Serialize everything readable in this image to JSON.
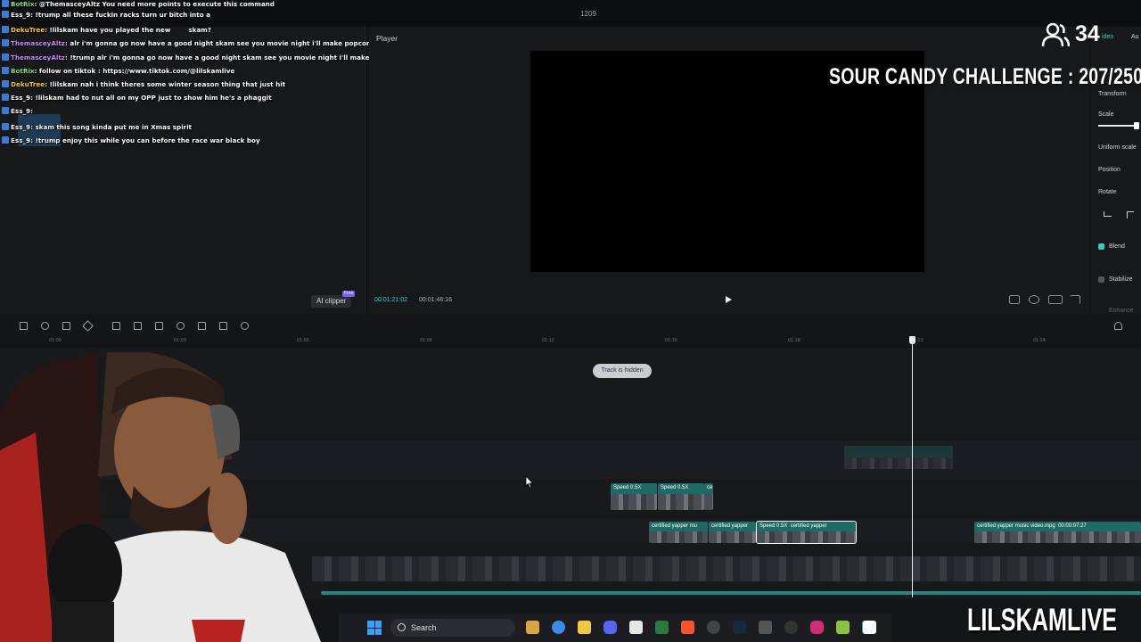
{
  "window": {
    "title": "1209"
  },
  "chat": [
    {
      "user": "BotRix",
      "user_color": "u-green",
      "text": ": @ThemasceyAltz You need more points to execute this command"
    },
    {
      "user": "Ess_9",
      "user_color": "u-white",
      "text": ": !trump all these fuckin racks turn ur bitch into a"
    },
    {
      "user": "DekuTree",
      "user_color": "u-gold",
      "text": ": !lilskam have you played the new",
      "extra": "skam?"
    },
    {
      "user": "ThemasceyAltz",
      "user_color": "u-purple",
      "text": ": alr i'm gonna go now have a good night skam see you movie night i'll make popcorn"
    },
    {
      "user": "ThemasceyAltz",
      "user_color": "u-purple",
      "text": ": !trump alr i'm gonna go now have a good night skam see you movie night i'll make popcorn"
    },
    {
      "user": "BotRix",
      "user_color": "u-green",
      "text": ": follow on tiktok : https://www.tiktok.com/@lilskamlive"
    },
    {
      "user": "DekuTree",
      "user_color": "u-gold",
      "text": ": !lilskam nah i think theres some winter season thing that just hit"
    },
    {
      "user": "Ess_9",
      "user_color": "u-white",
      "text": ": !lilskam had to nut all on my OPP just to show him he's a phaggit"
    },
    {
      "user": "Ess_9",
      "user_color": "u-white",
      "text": ":"
    },
    {
      "user": "Ess_9",
      "user_color": "u-white",
      "text": ": skam this song kinda put me in Xmas spirit"
    },
    {
      "user": "Ess_9",
      "user_color": "u-white",
      "text": ": !trump enjoy this while you can before the race war black boy"
    }
  ],
  "media_panel": {
    "ai_clipper_label": "AI clipper",
    "ai_clipper_badge": "Free"
  },
  "player": {
    "title": "Player",
    "current_time": "00:01:21:02",
    "total_time": "00:01:46:16"
  },
  "inspector": {
    "tab_video": "ideo",
    "tab_audio": "Au",
    "section_transform": "Transform",
    "scale": "Scale",
    "uniform_scale": "Uniform scale",
    "position": "Position",
    "rotate": "Rotate",
    "blend": "Blend",
    "stabilize": "Stabilize",
    "enhance": "Enhance"
  },
  "timeline": {
    "ruler": [
      "01:00",
      "01:03",
      "01:06",
      "01:09",
      "01:12",
      "01:15",
      "01:18",
      "01:21",
      "01:24"
    ],
    "hidden_track_label": "Track is hidden",
    "clips": {
      "speed_a": "Speed 0.5X",
      "speed_b": "Speed 0.5X",
      "speed_c": "ce",
      "yapper_a": "certified yapper mu",
      "yapper_b": "certified yapper",
      "speed_sel": "Speed 0.5X",
      "yapper_sel": "certified yapper",
      "yapper_end": "certified yapper music video.mpg",
      "yapper_end_time": "00:00:07:27"
    }
  },
  "taskbar": {
    "search_label": "Search"
  },
  "overlay": {
    "viewer_count": "34",
    "challenge": "SOUR CANDY CHALLENGE : 207/250",
    "brand": "LILSKAMLIVE"
  },
  "colors": {
    "accent": "#2fd0c4",
    "clip": "#1d6b63",
    "panel": "#17181a"
  }
}
